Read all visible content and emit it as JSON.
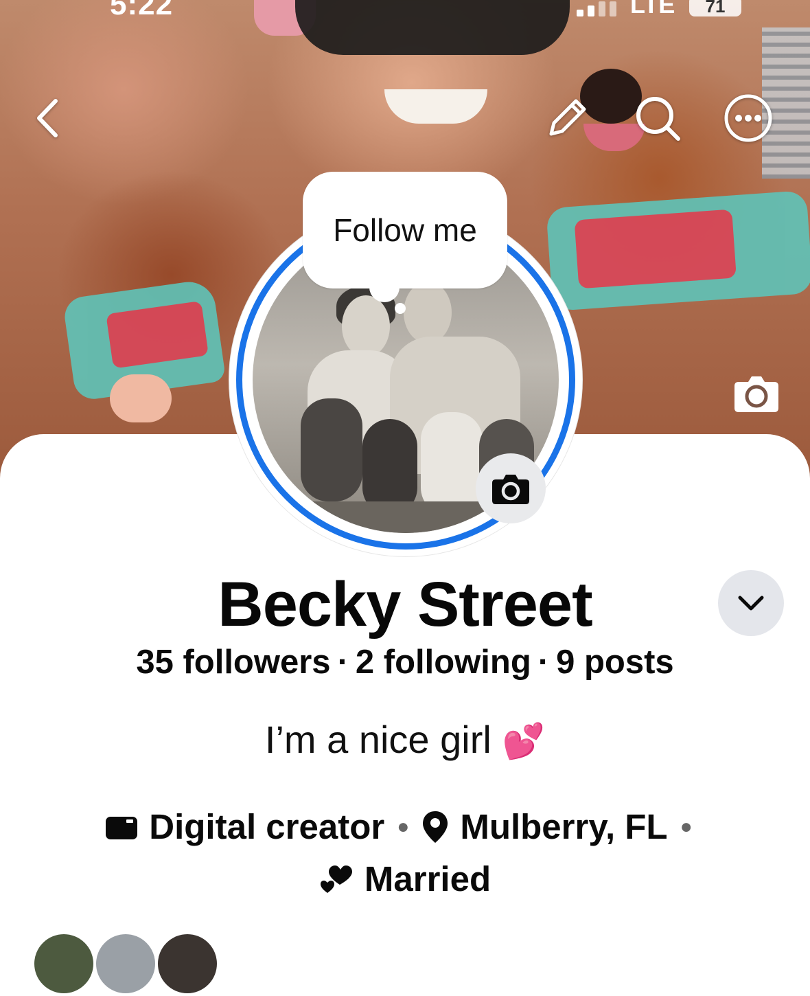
{
  "status_bar": {
    "time": "5:22",
    "network": "LTE",
    "battery": "71"
  },
  "nav": {
    "back_icon": "chevron-left-icon",
    "edit_icon": "pencil-icon",
    "search_icon": "search-icon",
    "more_icon": "more-horizontal-icon"
  },
  "note": {
    "text": "Follow me"
  },
  "profile": {
    "name": "Becky Street",
    "followers": "35 followers",
    "following": "2 following",
    "posts": "9 posts",
    "bio": "I’m a nice girl",
    "bio_emoji": "💕",
    "category": "Digital creator",
    "location": "Mulberry, FL",
    "relationship": "Married"
  },
  "colors": {
    "accent": "#1a73e8",
    "text": "#0a0a0a",
    "button_bg": "#e4e6eb",
    "heart": "#f0379b"
  }
}
